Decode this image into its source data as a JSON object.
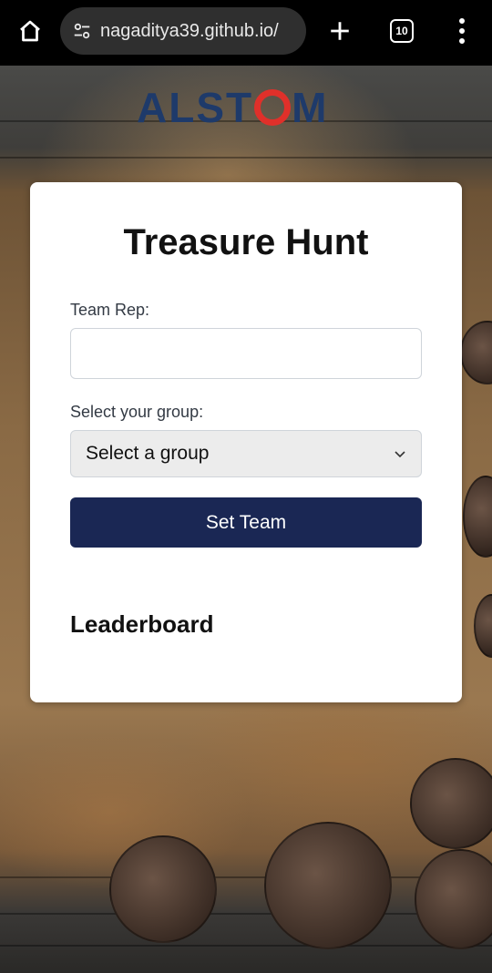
{
  "browser": {
    "url": "nagaditya39.github.io/",
    "tab_count": "10",
    "icons": {
      "home": "home-icon",
      "site_settings": "site-settings-icon",
      "new_tab": "plus-icon",
      "tabs": "tabs-icon",
      "menu": "more-vert-icon"
    }
  },
  "brand": {
    "logo_text_before": "ALST",
    "logo_text_after": "M",
    "colors": {
      "primary": "#1e3a6a",
      "accent": "#e0302a"
    }
  },
  "form": {
    "title": "Treasure Hunt",
    "team_rep_label": "Team Rep:",
    "team_rep_value": "",
    "group_label": "Select your group:",
    "group_selected": "Select a group",
    "submit_label": "Set Team",
    "button_color": "#1a2754"
  },
  "leaderboard": {
    "title": "Leaderboard"
  }
}
